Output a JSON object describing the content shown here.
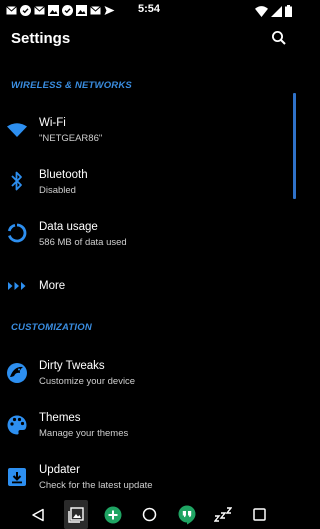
{
  "status_bar": {
    "time": "5:54",
    "left_icons": [
      "mail-icon",
      "check-icon",
      "mail-icon",
      "image-icon",
      "check-icon",
      "image-icon",
      "mail-icon",
      "send-icon"
    ],
    "right_icons": [
      "wifi-icon",
      "signal-icon",
      "battery-icon"
    ]
  },
  "app_bar": {
    "title": "Settings"
  },
  "sections": {
    "wireless": "WIRELESS & NETWORKS",
    "customization": "CUSTOMIZATION"
  },
  "items": {
    "wifi": {
      "title": "Wi-Fi",
      "subtitle": "\"NETGEAR86\""
    },
    "bluetooth": {
      "title": "Bluetooth",
      "subtitle": "Disabled"
    },
    "data_usage": {
      "title": "Data usage",
      "subtitle": "586 MB of data used"
    },
    "more": {
      "title": "More"
    },
    "dirty_tweaks": {
      "title": "Dirty Tweaks",
      "subtitle": "Customize your device"
    },
    "themes": {
      "title": "Themes",
      "subtitle": "Manage your themes"
    },
    "updater": {
      "title": "Updater",
      "subtitle": "Check for the latest update"
    }
  },
  "nav_bar": [
    "back-icon",
    "gallery-icon",
    "add-icon",
    "home-icon",
    "hangouts-icon",
    "sleep-icon",
    "recents-icon"
  ],
  "colors": {
    "accent": "#3a8de0",
    "background": "#000000"
  }
}
